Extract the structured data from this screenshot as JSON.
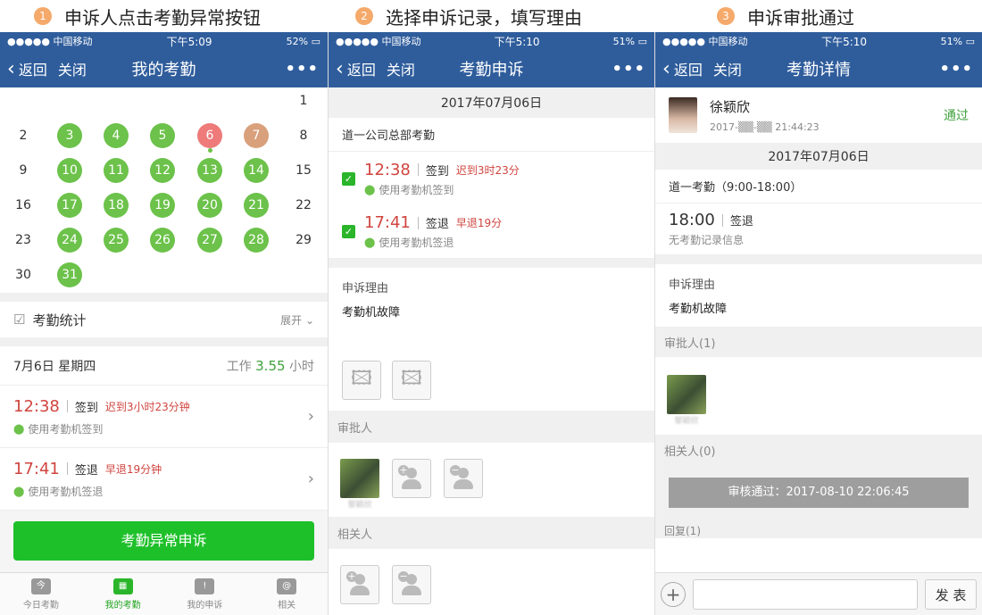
{
  "steps": [
    {
      "num": "1",
      "text": "申诉人点击考勤异常按钮"
    },
    {
      "num": "2",
      "text": "选择申诉记录，填写理由"
    },
    {
      "num": "3",
      "text": "申诉审批通过"
    }
  ],
  "screen1": {
    "status": {
      "carrier": "●●●●● 中国移动",
      "time": "下午5:09",
      "battery": "52%"
    },
    "nav": {
      "back": "返回",
      "close": "关闭",
      "title": "我的考勤",
      "more": "•••"
    },
    "calendar": {
      "days": [
        {
          "n": "1",
          "s": ""
        },
        {
          "n": "2",
          "s": ""
        },
        {
          "n": "3",
          "s": "g"
        },
        {
          "n": "4",
          "s": "g"
        },
        {
          "n": "5",
          "s": "g"
        },
        {
          "n": "6",
          "s": "r"
        },
        {
          "n": "7",
          "s": "o"
        },
        {
          "n": "8",
          "s": ""
        },
        {
          "n": "9",
          "s": ""
        },
        {
          "n": "10",
          "s": "g"
        },
        {
          "n": "11",
          "s": "g"
        },
        {
          "n": "12",
          "s": "g"
        },
        {
          "n": "13",
          "s": "g"
        },
        {
          "n": "14",
          "s": "g"
        },
        {
          "n": "15",
          "s": ""
        },
        {
          "n": "16",
          "s": ""
        },
        {
          "n": "17",
          "s": "g"
        },
        {
          "n": "18",
          "s": "g"
        },
        {
          "n": "19",
          "s": "g"
        },
        {
          "n": "20",
          "s": "g"
        },
        {
          "n": "21",
          "s": "g"
        },
        {
          "n": "22",
          "s": ""
        },
        {
          "n": "23",
          "s": ""
        },
        {
          "n": "24",
          "s": "g"
        },
        {
          "n": "25",
          "s": "g"
        },
        {
          "n": "26",
          "s": "g"
        },
        {
          "n": "27",
          "s": "g"
        },
        {
          "n": "28",
          "s": "g"
        },
        {
          "n": "29",
          "s": ""
        },
        {
          "n": "30",
          "s": ""
        },
        {
          "n": "31",
          "s": "g"
        }
      ]
    },
    "stats": {
      "label": "考勤统计",
      "expand": "展开"
    },
    "date": {
      "label": "7月6日 星期四",
      "work_prefix": "工作",
      "work_hours": "3.55",
      "work_suffix": "小时"
    },
    "records": [
      {
        "time": "12:38",
        "type": "签到",
        "note": "迟到3小时23分钟",
        "loc": "使用考勤机签到"
      },
      {
        "time": "17:41",
        "type": "签退",
        "note": "早退19分钟",
        "loc": "使用考勤机签退"
      }
    ],
    "button": "考勤异常申诉",
    "tabs": [
      {
        "icon": "今",
        "label": "今日考勤"
      },
      {
        "icon": "▦",
        "label": "我的考勤"
      },
      {
        "icon": "!",
        "label": "我的申诉"
      },
      {
        "icon": "@",
        "label": "相关"
      }
    ]
  },
  "screen2": {
    "status": {
      "carrier": "●●●●● 中国移动",
      "time": "下午5:10",
      "battery": "51%"
    },
    "nav": {
      "back": "返回",
      "close": "关闭",
      "title": "考勤申诉",
      "more": "•••"
    },
    "date": "2017年07月06日",
    "company": "道一公司总部考勤",
    "records": [
      {
        "time": "12:38",
        "type": "签到",
        "note": "迟到3时23分",
        "loc": "使用考勤机签到"
      },
      {
        "time": "17:41",
        "type": "签退",
        "note": "早退19分",
        "loc": "使用考勤机签退"
      }
    ],
    "reason_label": "申诉理由",
    "reason": "考勤机故障",
    "approver_label": "审批人",
    "approver_name": "黎颖欣",
    "related_label": "相关人"
  },
  "screen3": {
    "status": {
      "carrier": "●●●●● 中国移动",
      "time": "下午5:10",
      "battery": "51%"
    },
    "nav": {
      "back": "返回",
      "close": "关闭",
      "title": "考勤详情",
      "more": "•••"
    },
    "user": {
      "name": "徐颖欣",
      "time": "2017-▒▒-▒▒ 21:44:23",
      "status": "通过"
    },
    "date": "2017年07月06日",
    "shift": "道一考勤（9:00-18:00）",
    "record": {
      "time": "18:00",
      "type": "签退",
      "note": "无考勤记录信息"
    },
    "reason_label": "申诉理由",
    "reason": "考勤机故障",
    "approver_label": "审批人(1)",
    "approver_name": "黎颖欣",
    "related_label": "相关人(0)",
    "approval": "审核通过：2017-08-10 22:06:45",
    "reply_label": "回复(1)",
    "send": "发 表"
  }
}
